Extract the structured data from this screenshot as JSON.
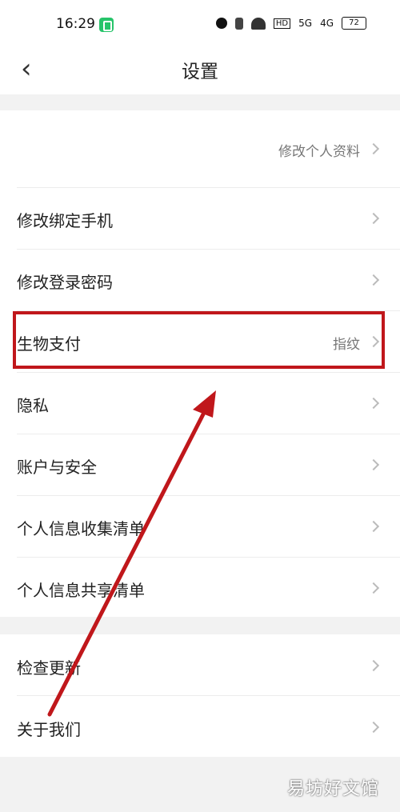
{
  "status_bar": {
    "time": "16:29",
    "battery": "72",
    "net1": "5G",
    "net2": "4G",
    "hd": "HD"
  },
  "nav": {
    "title": "设置"
  },
  "profile": {
    "edit_label": "修改个人资料"
  },
  "settings": [
    {
      "label": "修改绑定手机",
      "value": ""
    },
    {
      "label": "修改登录密码",
      "value": ""
    },
    {
      "label": "生物支付",
      "value": "指纹"
    },
    {
      "label": "隐私",
      "value": ""
    },
    {
      "label": "账户与安全",
      "value": ""
    },
    {
      "label": "个人信息收集清单",
      "value": ""
    },
    {
      "label": "个人信息共享清单",
      "value": ""
    }
  ],
  "about": [
    {
      "label": "检查更新"
    },
    {
      "label": "关于我们"
    }
  ],
  "watermark": "易坊好文馆",
  "colors": {
    "highlight": "#c0171b",
    "arrow": "#c0171b",
    "background": "#f2f2f2"
  }
}
